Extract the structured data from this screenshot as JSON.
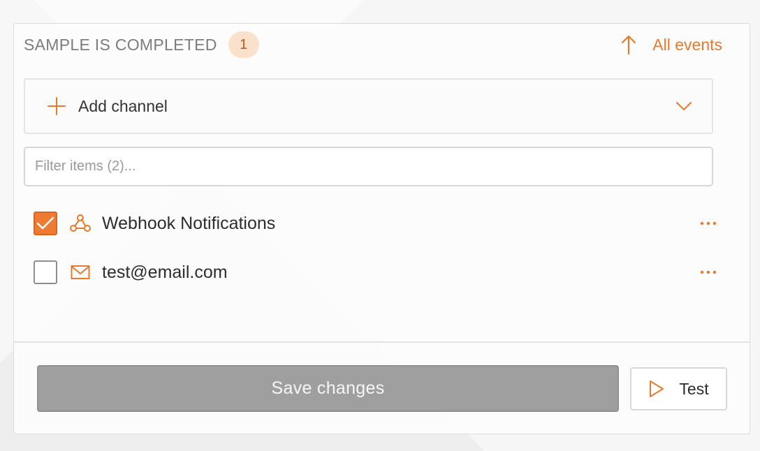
{
  "header": {
    "title": "SAMPLE IS COMPLETED",
    "count": "1",
    "all_events_label": "All events"
  },
  "add_channel": {
    "label": "Add channel"
  },
  "filter": {
    "placeholder": "Filter items (2)...",
    "value": ""
  },
  "channels": [
    {
      "name": "Webhook Notifications",
      "icon": "webhook-icon",
      "checked": true
    },
    {
      "name": "test@email.com",
      "icon": "mail-icon",
      "checked": false
    }
  ],
  "footer": {
    "save_label": "Save changes",
    "test_label": "Test"
  },
  "colors": {
    "accent": "#ef7b33",
    "badge_bg": "#f9e1cb",
    "save_disabled": "#9f9f9f"
  }
}
